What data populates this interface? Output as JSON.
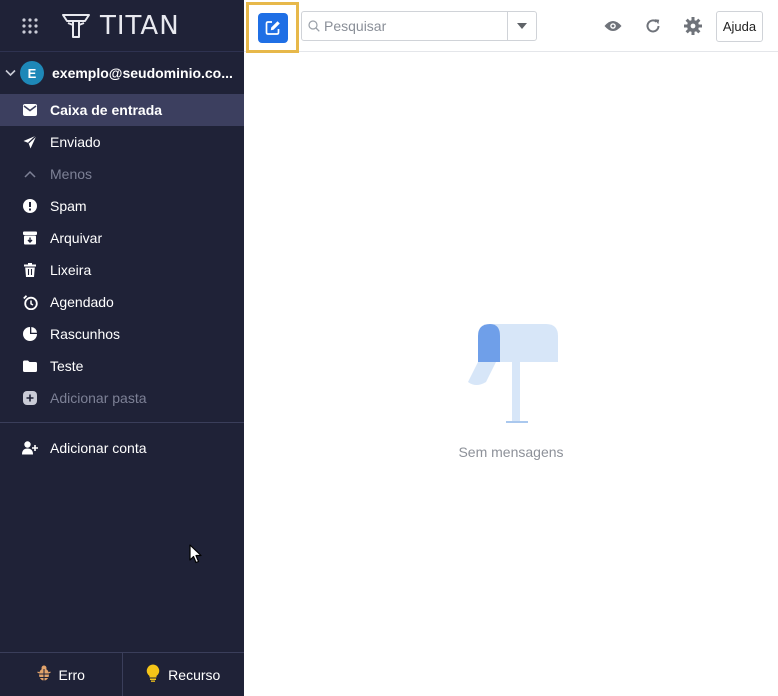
{
  "brand": {
    "name": "TITAN"
  },
  "account": {
    "email": "exemplo@seudominio.co...",
    "initial": "E"
  },
  "folders": [
    {
      "label": "Caixa de entrada",
      "icon": "envelope-icon",
      "active": true
    },
    {
      "label": "Enviado",
      "icon": "paper-plane-icon"
    },
    {
      "label": "Menos",
      "icon": "chevron-up-icon",
      "muted": true
    },
    {
      "label": "Spam",
      "icon": "exclamation-circle-icon"
    },
    {
      "label": "Arquivar",
      "icon": "archive-icon"
    },
    {
      "label": "Lixeira",
      "icon": "trash-icon"
    },
    {
      "label": "Agendado",
      "icon": "clock-icon"
    },
    {
      "label": "Rascunhos",
      "icon": "draft-icon"
    },
    {
      "label": "Teste",
      "icon": "folder-icon"
    },
    {
      "label": "Adicionar pasta",
      "icon": "plus-circle-icon",
      "muted": true
    }
  ],
  "add_account": {
    "label": "Adicionar conta"
  },
  "footer": {
    "bug_label": "Erro",
    "feature_label": "Recurso"
  },
  "toolbar": {
    "search_placeholder": "Pesquisar",
    "help_label": "Ajuda"
  },
  "main": {
    "empty_text": "Sem mensagens"
  },
  "colors": {
    "sidebar_bg": "#1f2237",
    "active_item": "#3c3f5f",
    "compose_blue": "#1f6fe5",
    "highlight": "#e7b84a",
    "avatar": "#1e88b8"
  }
}
